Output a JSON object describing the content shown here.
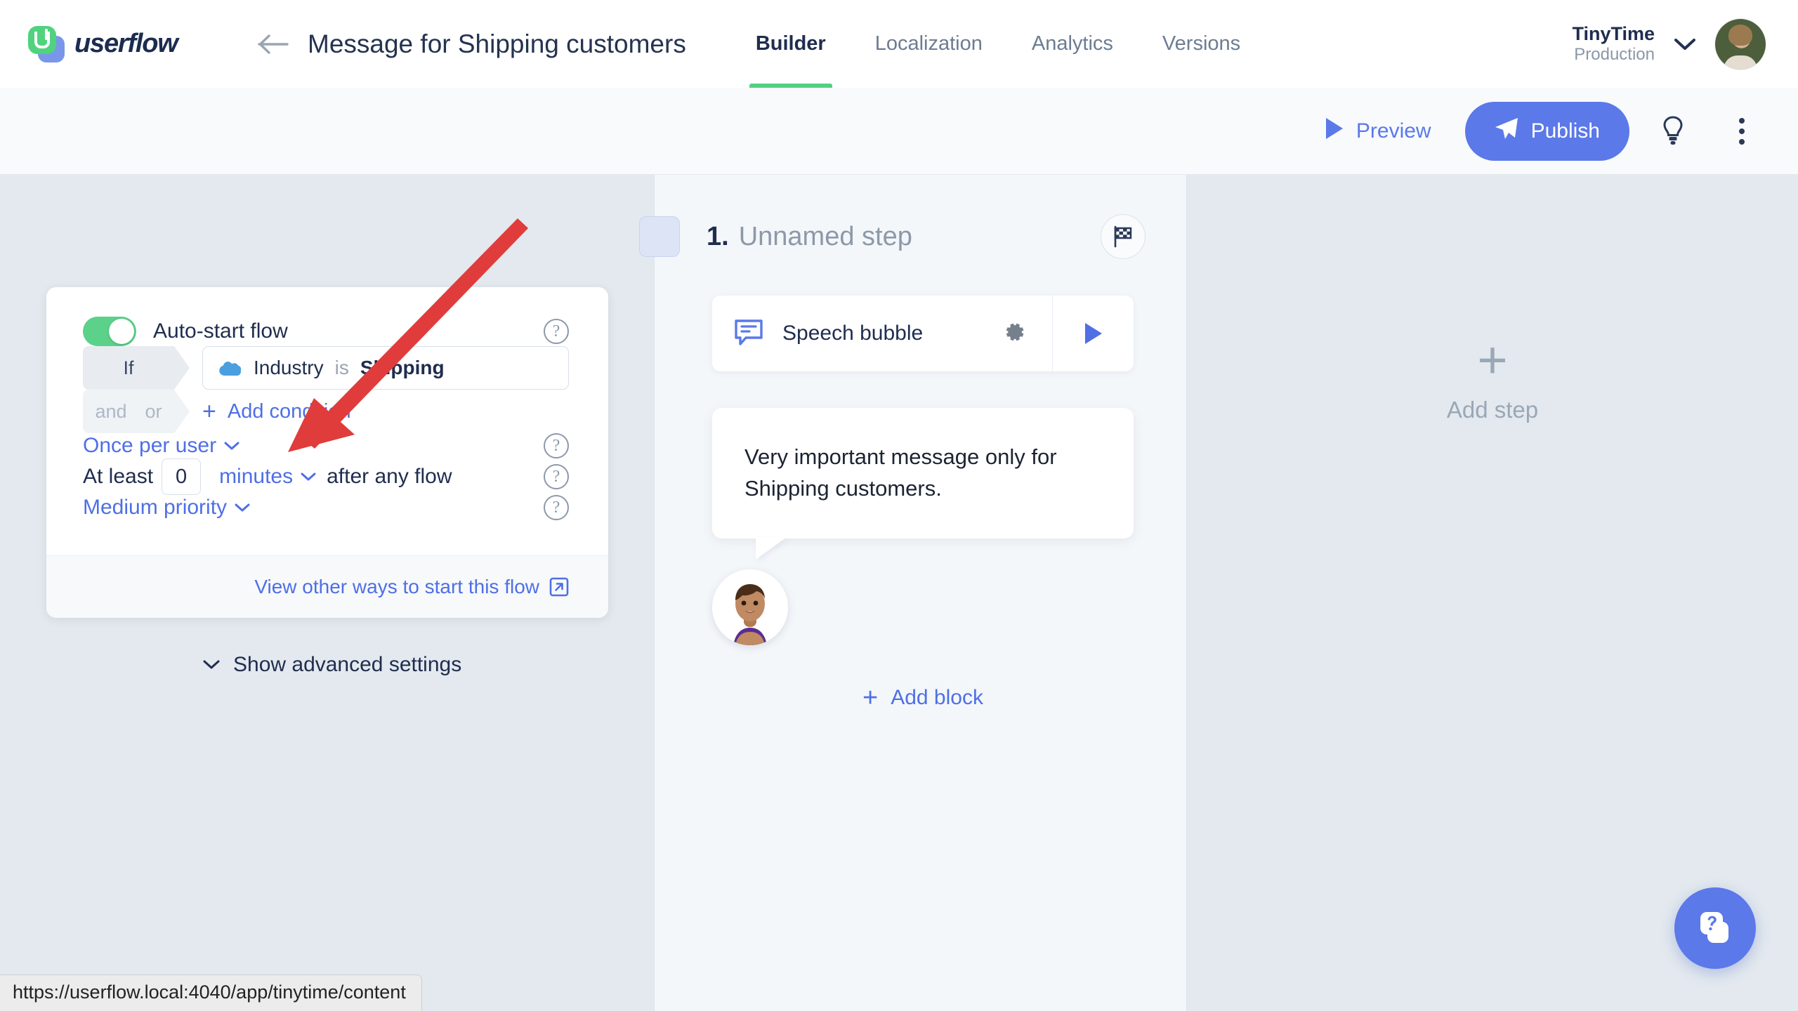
{
  "app": {
    "logo_text": "userflow",
    "page_title": "Message for Shipping customers"
  },
  "nav": {
    "back_icon": "arrow-left-icon",
    "tabs": [
      {
        "label": "Builder",
        "active": true
      },
      {
        "label": "Localization",
        "active": false
      },
      {
        "label": "Analytics",
        "active": false
      },
      {
        "label": "Versions",
        "active": false
      }
    ],
    "account": {
      "name": "TinyTime",
      "environment": "Production",
      "chevron_icon": "chevron-down-icon",
      "avatar_icon": "user-avatar-photo"
    }
  },
  "toolbar": {
    "preview_label": "Preview",
    "preview_icon": "play-icon",
    "publish_label": "Publish",
    "publish_icon": "paper-plane-icon",
    "hint_icon": "lightbulb-icon",
    "more_icon": "more-vertical-icon",
    "accent_color": "#5b79e8"
  },
  "settings": {
    "auto_start": {
      "label": "Auto-start flow",
      "enabled": true,
      "toggle_color": "#5bd189",
      "help_icon": "help-circle-icon"
    },
    "condition": {
      "tag_label": "If",
      "attribute_icon": "salesforce-cloud-icon",
      "attribute": "Industry",
      "operator": "is",
      "value": "Shipping"
    },
    "add_condition": {
      "and_label": "and",
      "or_label": "or",
      "plus_icon": "plus-icon",
      "label": "Add condition"
    },
    "frequency": {
      "label": "Once per user",
      "chevron_icon": "chevron-down-icon",
      "help_icon": "help-circle-icon"
    },
    "delay": {
      "prefix": "At least",
      "value": "0",
      "unit": "minutes",
      "unit_chevron_icon": "chevron-down-icon",
      "suffix": "after any flow",
      "help_icon": "help-circle-icon"
    },
    "priority": {
      "label": "Medium priority",
      "chevron_icon": "chevron-down-icon",
      "help_icon": "help-circle-icon"
    },
    "footer_link": {
      "label": "View other ways to start this flow",
      "icon": "external-link-icon"
    },
    "advanced": {
      "label": "Show advanced settings",
      "chevron_icon": "chevron-down-icon"
    }
  },
  "step": {
    "drag_handle_icon": "drag-handle",
    "number": "1.",
    "name": "Unnamed step",
    "flag_icon": "checkered-flag-icon",
    "block": {
      "icon": "speech-bubble-icon",
      "name": "Speech bubble",
      "settings_icon": "gear-icon",
      "play_icon": "play-icon"
    },
    "message": "Very important message only for Shipping customers.",
    "persona_icon": "persona-avatar-illustration",
    "add_block": {
      "plus_icon": "plus-icon",
      "label": "Add block"
    }
  },
  "add_step": {
    "plus_icon": "plus-icon",
    "label": "Add step"
  },
  "helper": {
    "icon": "help-cards-icon",
    "color": "#5b79e8"
  },
  "status_bar": {
    "url": "https://userflow.local:4040/app/tinytime/content"
  },
  "annotation": {
    "arrow_color": "#e03c3c"
  }
}
